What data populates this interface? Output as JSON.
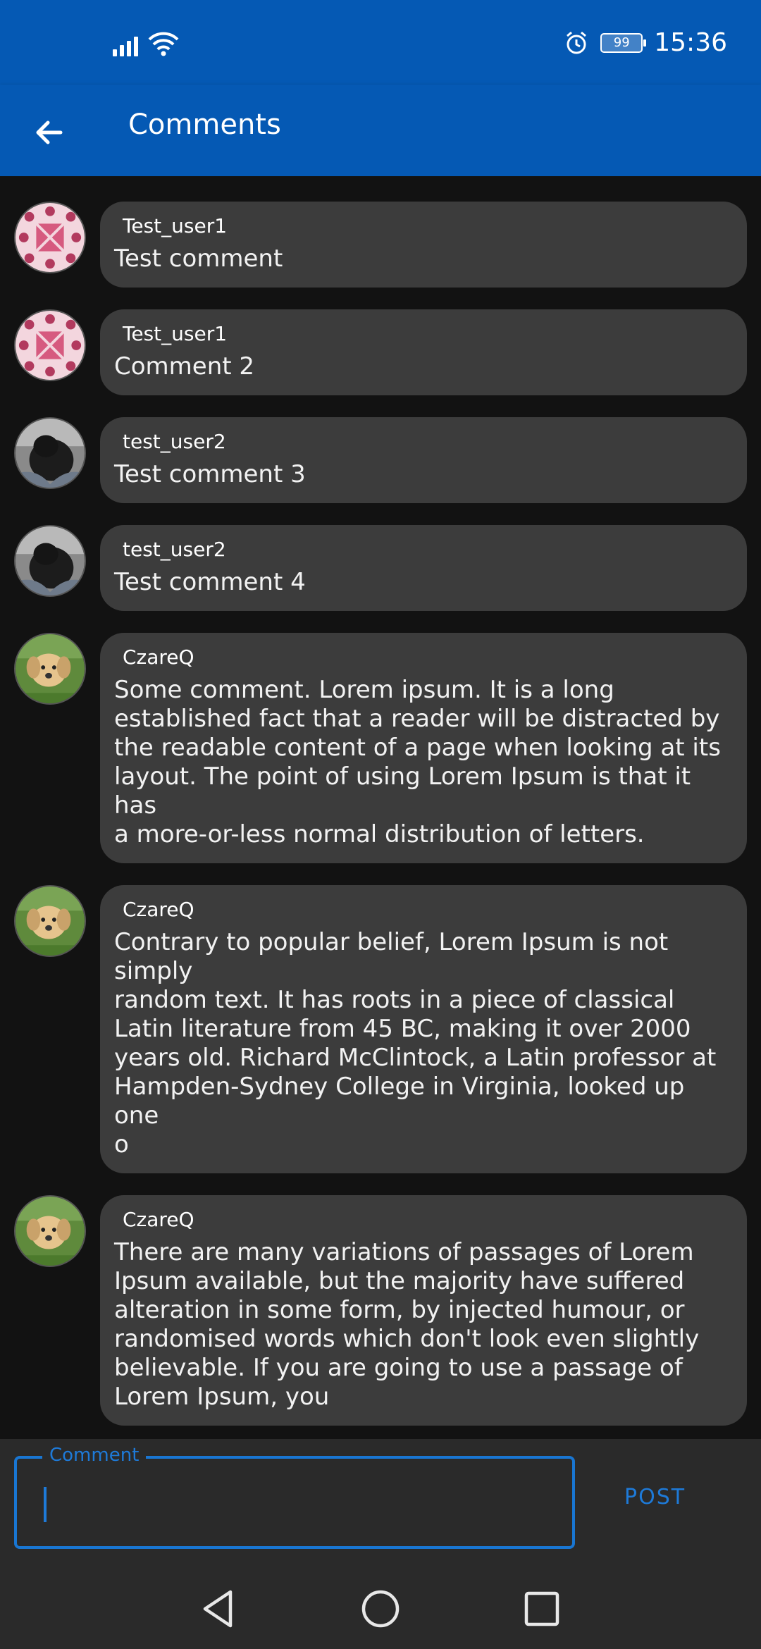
{
  "status_bar": {
    "time": "15:36",
    "battery": "99",
    "icons": [
      "signal-icon",
      "wifi-icon",
      "alarm-icon",
      "battery-icon"
    ]
  },
  "app_bar": {
    "title": "Comments",
    "back_icon": "arrow-back-icon"
  },
  "comments": [
    {
      "username": "Test_user1",
      "text": "Test comment",
      "avatar": "pattern-avatar"
    },
    {
      "username": "Test_user1",
      "text": "Comment 2",
      "avatar": "pattern-avatar"
    },
    {
      "username": "test_user2",
      "text": "Test comment 3",
      "avatar": "dark-dog-avatar"
    },
    {
      "username": "test_user2",
      "text": "Test comment 4",
      "avatar": "dark-dog-avatar"
    },
    {
      "username": "CzareQ",
      "text": "Some comment. Lorem ipsum. It is a long\nestablished fact that a reader will be distracted by\nthe readable content of a page when looking at its\nlayout. The point of using Lorem Ipsum is that it has\na more-or-less normal distribution of letters.",
      "avatar": "puppy-avatar"
    },
    {
      "username": "CzareQ",
      "text": "Contrary to popular belief, Lorem Ipsum is not simply\nrandom text. It has roots in a piece of classical\nLatin literature from 45 BC, making it over 2000\nyears old. Richard McClintock, a Latin professor at\nHampden-Sydney College in Virginia, looked up one\no",
      "avatar": "puppy-avatar"
    },
    {
      "username": "CzareQ",
      "text": "There are many variations of passages of Lorem\nIpsum available, but the majority have suffered\nalteration in some form, by injected humour, or\nrandomised words which don't look even slightly\nbelievable. If you are going to use a passage of\nLorem Ipsum, you",
      "avatar": "puppy-avatar"
    }
  ],
  "input": {
    "label": "Comment",
    "value": "",
    "post_label": "POST"
  },
  "nav": {
    "icons": [
      "back-triangle-icon",
      "home-circle-icon",
      "recents-square-icon"
    ]
  },
  "colors": {
    "primary": "#0559b4",
    "accent": "#1e7ad8",
    "bubble": "#3c3c3c",
    "background": "#121212"
  }
}
